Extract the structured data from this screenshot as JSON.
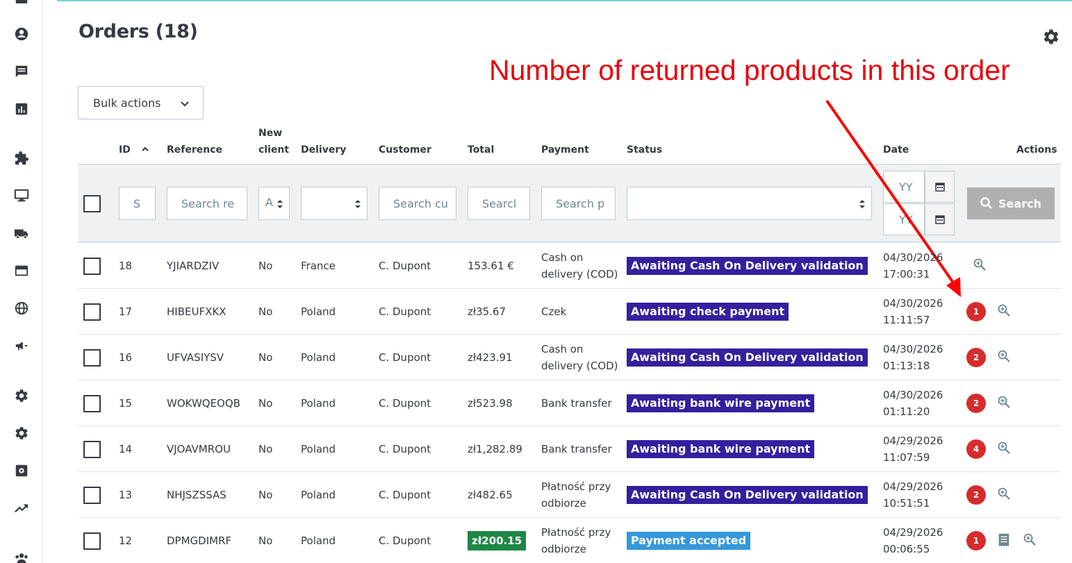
{
  "page": {
    "title": "Orders (18)"
  },
  "annotation": {
    "text": "Number of returned products in this order"
  },
  "toolbar": {
    "bulk_actions_label": "Bulk actions"
  },
  "sidebar": {
    "icons": [
      "dashboard-icon",
      "customer-icon",
      "messages-icon",
      "stats-icon",
      "modules-icon",
      "design-icon",
      "shipping-icon",
      "payment-icon",
      "international-icon",
      "marketing-icon",
      "settings-icon",
      "advanced-settings-icon",
      "extension-icon",
      "trending-icon",
      "team-icon"
    ]
  },
  "table": {
    "headers": {
      "id": "ID",
      "reference": "Reference",
      "new_client_line1": "New",
      "new_client_line2": "client",
      "delivery": "Delivery",
      "customer": "Customer",
      "total": "Total",
      "payment": "Payment",
      "status": "Status",
      "date": "Date",
      "actions": "Actions"
    },
    "filters": {
      "id_placeholder": "S",
      "reference_placeholder": "Search re",
      "new_client_value": "A",
      "customer_placeholder": "Search cu",
      "total_placeholder": "Searcl",
      "payment_placeholder": "Search p",
      "date_from_placeholder": "YY",
      "date_to_placeholder": "YY",
      "search_button": "Search"
    },
    "rows": [
      {
        "id": "18",
        "reference": "YJIARDZIV",
        "new_client": "No",
        "delivery": "France",
        "customer": "C. Dupont",
        "total": "153.61 €",
        "total_highlight": false,
        "payment_line1": "Cash on",
        "payment_line2": "delivery (COD)",
        "status": "Awaiting Cash On Delivery validation",
        "status_color": "#34209e",
        "date_line1": "04/30/2026",
        "date_line2": "17:00:31",
        "returns": ""
      },
      {
        "id": "17",
        "reference": "HIBEUFXKX",
        "new_client": "No",
        "delivery": "Poland",
        "customer": "C. Dupont",
        "total": "zł35.67",
        "total_highlight": false,
        "payment_line1": "Czek",
        "payment_line2": "",
        "status": "Awaiting check payment",
        "status_color": "#34209e",
        "date_line1": "04/30/2026",
        "date_line2": "11:11:57",
        "returns": "1"
      },
      {
        "id": "16",
        "reference": "UFVASIYSV",
        "new_client": "No",
        "delivery": "Poland",
        "customer": "C. Dupont",
        "total": "zł423.91",
        "total_highlight": false,
        "payment_line1": "Cash on",
        "payment_line2": "delivery (COD)",
        "status": "Awaiting Cash On Delivery validation",
        "status_color": "#34209e",
        "date_line1": "04/30/2026",
        "date_line2": "01:13:18",
        "returns": "2"
      },
      {
        "id": "15",
        "reference": "WOKWQEOQB",
        "new_client": "No",
        "delivery": "Poland",
        "customer": "C. Dupont",
        "total": "zł523.98",
        "total_highlight": false,
        "payment_line1": "Bank transfer",
        "payment_line2": "",
        "status": "Awaiting bank wire payment",
        "status_color": "#34209e",
        "date_line1": "04/30/2026",
        "date_line2": "01:11:20",
        "returns": "2"
      },
      {
        "id": "14",
        "reference": "VJOAVMROU",
        "new_client": "No",
        "delivery": "Poland",
        "customer": "C. Dupont",
        "total": "zł1,282.89",
        "total_highlight": false,
        "payment_line1": "Bank transfer",
        "payment_line2": "",
        "status": "Awaiting bank wire payment",
        "status_color": "#34209e",
        "date_line1": "04/29/2026",
        "date_line2": "11:07:59",
        "returns": "4"
      },
      {
        "id": "13",
        "reference": "NHJSZSSAS",
        "new_client": "No",
        "delivery": "Poland",
        "customer": "C. Dupont",
        "total": "zł482.65",
        "total_highlight": false,
        "payment_line1": "Płatność przy",
        "payment_line2": "odbiorze",
        "status": "Awaiting Cash On Delivery validation",
        "status_color": "#34209e",
        "date_line1": "04/29/2026",
        "date_line2": "10:51:51",
        "returns": "2"
      },
      {
        "id": "12",
        "reference": "DPMGDIMRF",
        "new_client": "No",
        "delivery": "Poland",
        "customer": "C. Dupont",
        "total": "zł200.15",
        "total_highlight": true,
        "payment_line1": "Płatność przy",
        "payment_line2": "odbiorze",
        "status": "Payment accepted",
        "status_color": "#3498db",
        "date_line1": "04/29/2026",
        "date_line2": "00:06:55",
        "returns": "1",
        "has_invoice": true
      }
    ]
  },
  "colors": {
    "annotation": "#e8000b",
    "returns_badge": "#d62c2c",
    "total_paid_badge": "#1e8745"
  }
}
